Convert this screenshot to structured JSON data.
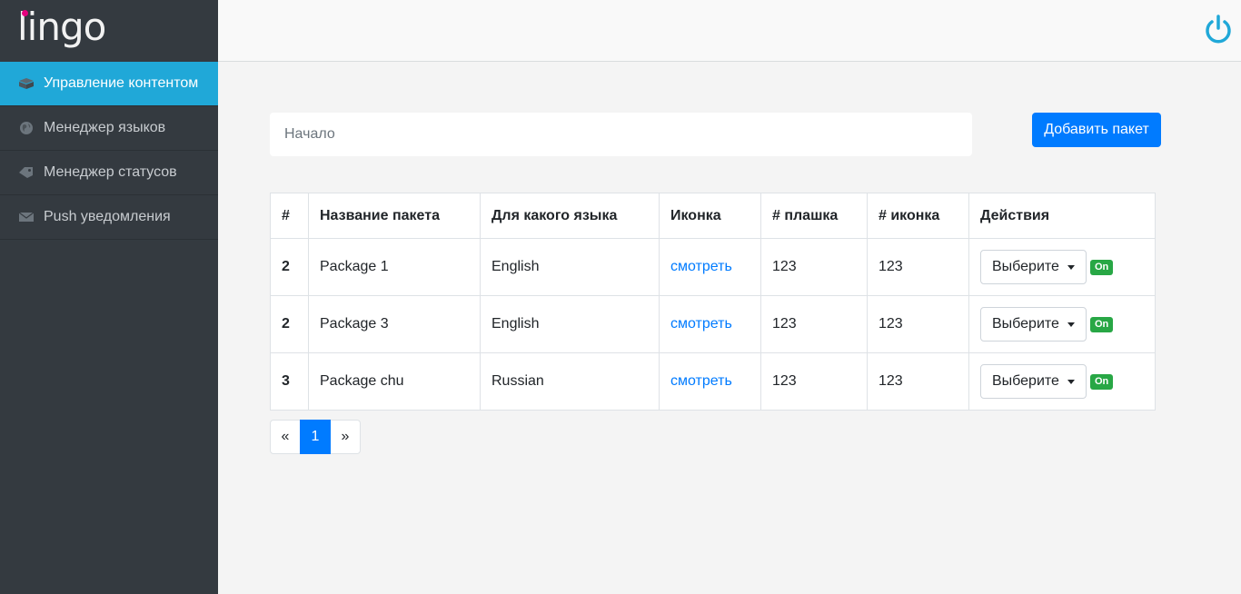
{
  "app": {
    "logo": "lingo"
  },
  "sidebar": {
    "items": [
      {
        "label": "Управление контентом",
        "icon": "box-icon",
        "active": true
      },
      {
        "label": "Менеджер языков",
        "icon": "globe-icon",
        "active": false
      },
      {
        "label": "Менеджер статусов",
        "icon": "tags-icon",
        "active": false
      },
      {
        "label": "Push уведомления",
        "icon": "envelope-icon",
        "active": false
      }
    ]
  },
  "topbar": {
    "icon": "power-icon"
  },
  "search": {
    "placeholder": "Начало"
  },
  "toolbar": {
    "add_label": "Добавить пакет"
  },
  "table": {
    "columns": [
      "#",
      "Название пакета",
      "Для какого языка",
      "Иконка",
      "# плашка",
      "# иконка",
      "Действия"
    ],
    "rows": [
      {
        "id": "2",
        "name": "Package 1",
        "language": "English",
        "icon_link": "смотреть",
        "plate": "123",
        "icon_num": "123",
        "action": "Выберите",
        "status": "On"
      },
      {
        "id": "2",
        "name": "Package 3",
        "language": "English",
        "icon_link": "смотреть",
        "plate": "123",
        "icon_num": "123",
        "action": "Выберите",
        "status": "On"
      },
      {
        "id": "3",
        "name": "Package chu",
        "language": "Russian",
        "icon_link": "смотреть",
        "plate": "123",
        "icon_num": "123",
        "action": "Выберите",
        "status": "On"
      }
    ]
  },
  "pagination": {
    "prev": "«",
    "current": "1",
    "next": "»"
  },
  "colors": {
    "accent": "#20a8d8",
    "primary": "#007bff",
    "success": "#28a745",
    "sidebar": "#343a40"
  }
}
